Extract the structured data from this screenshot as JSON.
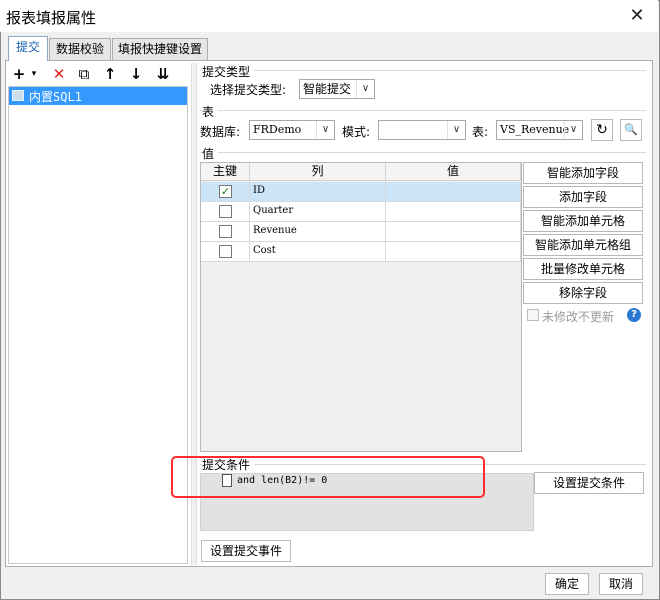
{
  "window": {
    "title": "报表填报属性",
    "close_glyph": "✕"
  },
  "tabs": [
    {
      "label": "提交",
      "active": true
    },
    {
      "label": "数据校验",
      "active": false
    },
    {
      "label": "填报快捷键设置",
      "active": false
    }
  ],
  "left_toolbar": {
    "add_icon": "add-icon",
    "add_glyph": "+",
    "add_dropdown_glyph": "▾",
    "delete_icon": "delete-icon",
    "delete_glyph": "✕",
    "copy_icon": "copy-icon",
    "copy_glyph": "⧉",
    "move_up_glyph": "↑",
    "move_down_glyph": "↓",
    "sort_glyph": "⇊"
  },
  "left_list": {
    "items": [
      {
        "label": "内置SQL1",
        "selected": true
      }
    ]
  },
  "submit_type": {
    "group_title": "提交类型",
    "label": "选择提交类型:",
    "value": "智能提交"
  },
  "table_section": {
    "group_title": "表",
    "database_label": "数据库:",
    "database_value": "FRDemo",
    "schema_label": "模式:",
    "schema_value": "",
    "table_label": "表:",
    "table_value": "VS_Revenue",
    "refresh_glyph": "↻",
    "preview_glyph": "🔍"
  },
  "values_section": {
    "group_title": "值",
    "columns": [
      "主键",
      "列",
      "值"
    ],
    "rows": [
      {
        "key": true,
        "column": "ID",
        "value": "",
        "selected": true
      },
      {
        "key": false,
        "column": "Quarter",
        "value": "",
        "selected": false
      },
      {
        "key": false,
        "column": "Revenue",
        "value": "",
        "selected": false
      },
      {
        "key": false,
        "column": "Cost",
        "value": "",
        "selected": false
      }
    ],
    "check_glyph": "✓"
  },
  "side_buttons": {
    "smart_add_field": "智能添加字段",
    "add_field": "添加字段",
    "smart_add_cell": "智能添加单元格",
    "smart_add_cell_group": "智能添加单元格组",
    "batch_edit_cell": "批量修改单元格",
    "remove_field": "移除字段",
    "unchanged_no_update": "未修改不更新",
    "help_glyph": "?"
  },
  "condition": {
    "group_title": "提交条件",
    "expression": "and len(B2)!= 0",
    "set_button": "设置提交条件"
  },
  "event_button": "设置提交事件",
  "footer": {
    "ok": "确定",
    "cancel": "取消"
  },
  "colors": {
    "selection": "#3399ff",
    "grid_selection": "#cce4f7",
    "highlight": "#ff2a2a",
    "tab_active_text": "#1a5fb4"
  }
}
